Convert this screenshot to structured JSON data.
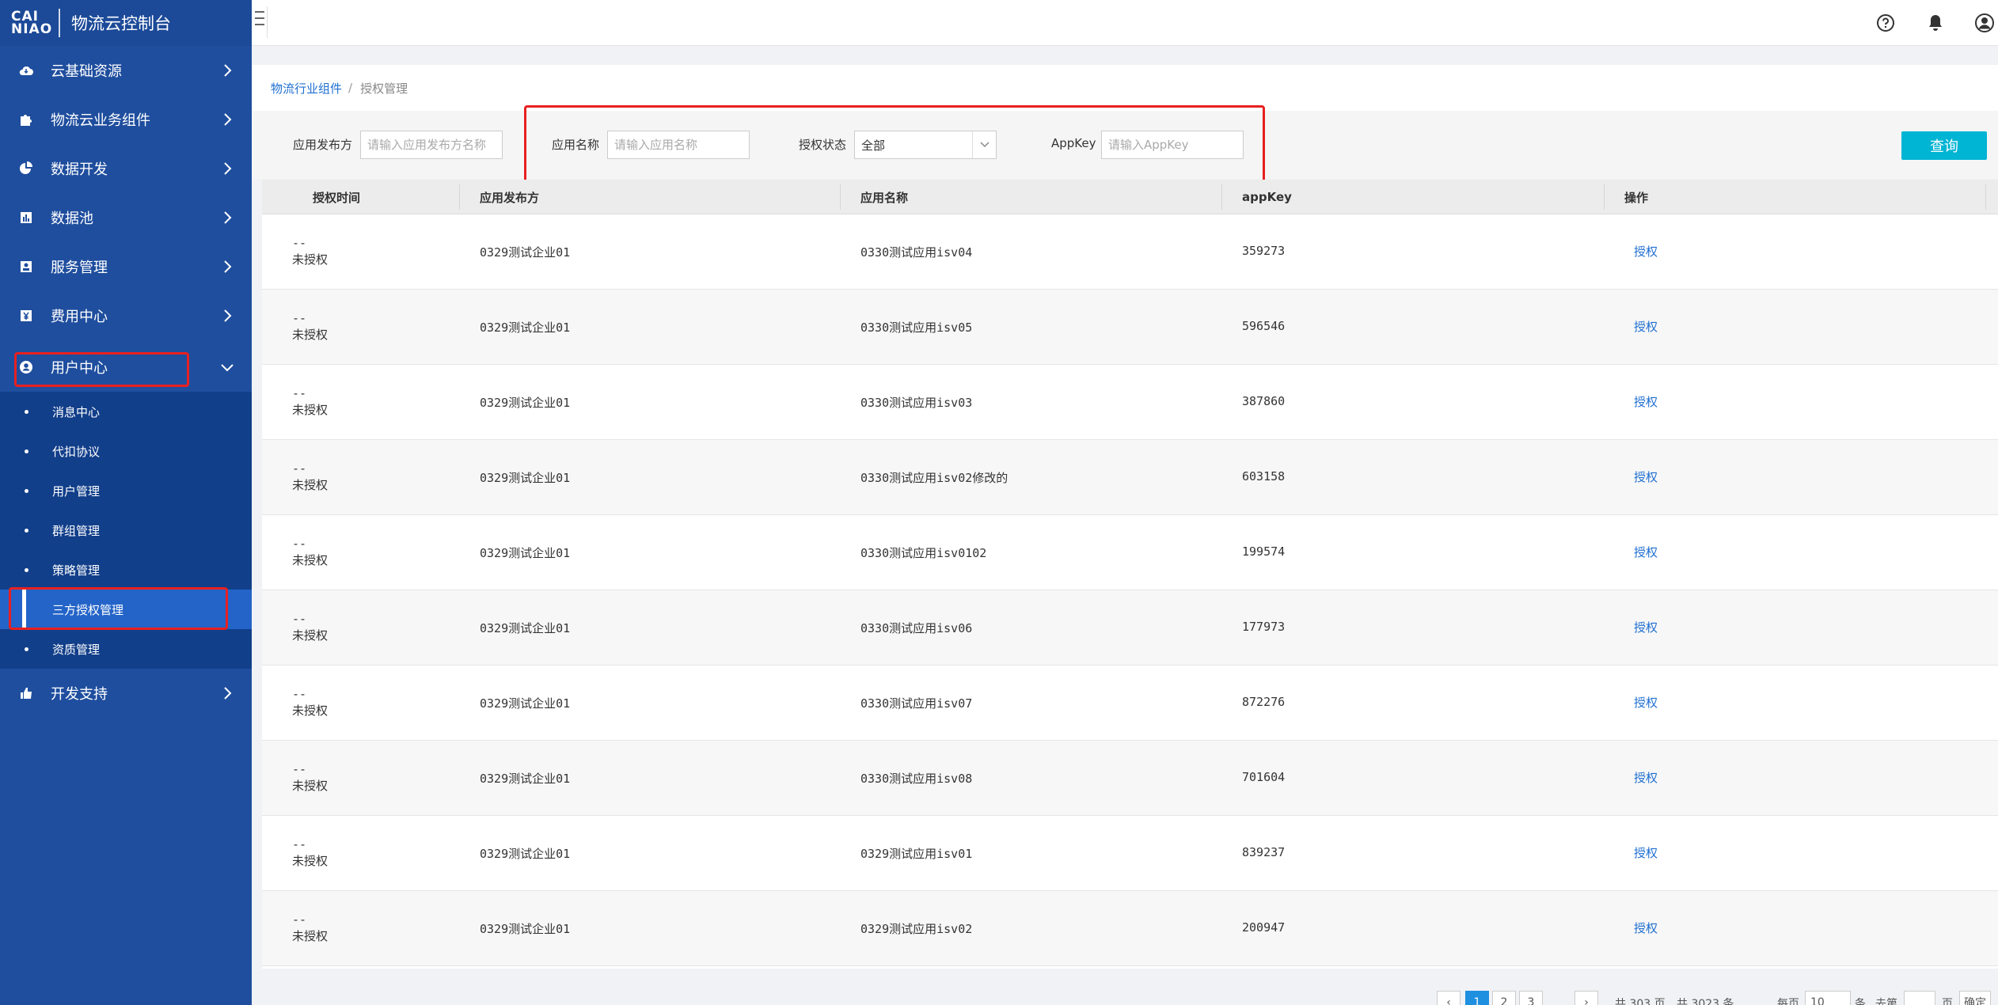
{
  "sidebar": {
    "logo": "CAI NIAO",
    "title": "物流云控制台",
    "menu": [
      {
        "label": "云基础资源"
      },
      {
        "label": "物流云业务组件"
      },
      {
        "label": "数据开发"
      },
      {
        "label": "数据池"
      },
      {
        "label": "服务管理"
      },
      {
        "label": "费用中心"
      },
      {
        "label": "用户中心"
      },
      {
        "label": "开发支持"
      }
    ],
    "submenu": [
      {
        "label": "消息中心"
      },
      {
        "label": "代扣协议"
      },
      {
        "label": "用户管理"
      },
      {
        "label": "群组管理"
      },
      {
        "label": "策略管理"
      },
      {
        "label": "三方授权管理"
      },
      {
        "label": "资质管理"
      }
    ]
  },
  "breadcrumb": {
    "parent": "物流行业组件",
    "sep": "/",
    "current": "授权管理"
  },
  "filters": {
    "publisher_label": "应用发布方",
    "publisher_placeholder": "请输入应用发布方名称",
    "appname_label": "应用名称",
    "appname_placeholder": "请输入应用名称",
    "status_label": "授权状态",
    "status_value": "全部",
    "appkey_label": "AppKey",
    "appkey_placeholder": "请输入AppKey",
    "query_label": "查询"
  },
  "table": {
    "headers": [
      "授权时间",
      "应用发布方",
      "应用名称",
      "appKey",
      "操作"
    ],
    "rows": [
      {
        "time": "--",
        "status": "未授权",
        "publisher": "0329测试企业01",
        "app": "0330测试应用isv04",
        "key": "359273",
        "action": "授权"
      },
      {
        "time": "--",
        "status": "未授权",
        "publisher": "0329测试企业01",
        "app": "0330测试应用isv05",
        "key": "596546",
        "action": "授权"
      },
      {
        "time": "--",
        "status": "未授权",
        "publisher": "0329测试企业01",
        "app": "0330测试应用isv03",
        "key": "387860",
        "action": "授权"
      },
      {
        "time": "--",
        "status": "未授权",
        "publisher": "0329测试企业01",
        "app": "0330测试应用isv02修改的",
        "key": "603158",
        "action": "授权"
      },
      {
        "time": "--",
        "status": "未授权",
        "publisher": "0329测试企业01",
        "app": "0330测试应用isv0102",
        "key": "199574",
        "action": "授权"
      },
      {
        "time": "--",
        "status": "未授权",
        "publisher": "0329测试企业01",
        "app": "0330测试应用isv06",
        "key": "177973",
        "action": "授权"
      },
      {
        "time": "--",
        "status": "未授权",
        "publisher": "0329测试企业01",
        "app": "0330测试应用isv07",
        "key": "872276",
        "action": "授权"
      },
      {
        "time": "--",
        "status": "未授权",
        "publisher": "0329测试企业01",
        "app": "0330测试应用isv08",
        "key": "701604",
        "action": "授权"
      },
      {
        "time": "--",
        "status": "未授权",
        "publisher": "0329测试企业01",
        "app": "0329测试应用isv01",
        "key": "839237",
        "action": "授权"
      },
      {
        "time": "--",
        "status": "未授权",
        "publisher": "0329测试企业01",
        "app": "0329测试应用isv02",
        "key": "200947",
        "action": "授权"
      }
    ]
  },
  "pagination": {
    "prev": "‹",
    "pages": [
      "1",
      "2",
      "3"
    ],
    "next": "›",
    "total_pages": "共 303 页",
    "total_items": "共 3023 条",
    "per_page_label": "每页",
    "per_page_value": "10",
    "per_page_unit": "条",
    "goto_label": "去第",
    "goto_unit": "页",
    "confirm": "确定"
  },
  "colors": {
    "sidebar": "#1f4e9e",
    "accent": "#00b4d4",
    "highlight": "#e82020",
    "link": "#1f6fd1"
  }
}
